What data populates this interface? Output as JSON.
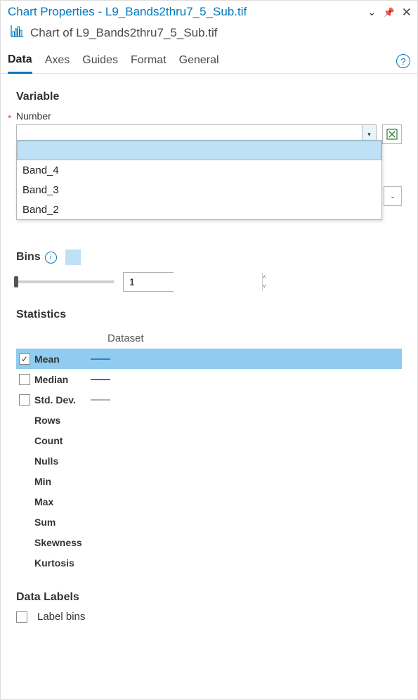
{
  "titlebar": {
    "title": "Chart Properties - L9_Bands2thru7_5_Sub.tif"
  },
  "subtitle": {
    "text": "Chart of L9_Bands2thru7_5_Sub.tif"
  },
  "tabs": {
    "items": [
      {
        "label": "Data",
        "active": true
      },
      {
        "label": "Axes",
        "active": false
      },
      {
        "label": "Guides",
        "active": false
      },
      {
        "label": "Format",
        "active": false
      },
      {
        "label": "General",
        "active": false
      }
    ]
  },
  "variable": {
    "section_title": "Variable",
    "number_label": "Number",
    "dropdown_options": [
      {
        "label": "",
        "selected": true
      },
      {
        "label": "Band_4",
        "selected": false
      },
      {
        "label": "Band_3",
        "selected": false
      },
      {
        "label": "Band_2",
        "selected": false
      }
    ]
  },
  "bins": {
    "title": "Bins",
    "value": "1"
  },
  "statistics": {
    "title": "Statistics",
    "column_header": "Dataset",
    "rows": [
      {
        "label": "Mean",
        "checkable": true,
        "checked": true,
        "color": "#3c78d8",
        "selected": true
      },
      {
        "label": "Median",
        "checkable": true,
        "checked": false,
        "color": "#9b3fa8",
        "selected": false
      },
      {
        "label": "Std. Dev.",
        "checkable": true,
        "checked": false,
        "color": "#b0b0b0",
        "selected": false
      },
      {
        "label": "Rows",
        "checkable": false
      },
      {
        "label": "Count",
        "checkable": false
      },
      {
        "label": "Nulls",
        "checkable": false
      },
      {
        "label": "Min",
        "checkable": false
      },
      {
        "label": "Max",
        "checkable": false
      },
      {
        "label": "Sum",
        "checkable": false
      },
      {
        "label": "Skewness",
        "checkable": false
      },
      {
        "label": "Kurtosis",
        "checkable": false
      }
    ]
  },
  "data_labels": {
    "title": "Data Labels",
    "label_bins": "Label bins"
  }
}
